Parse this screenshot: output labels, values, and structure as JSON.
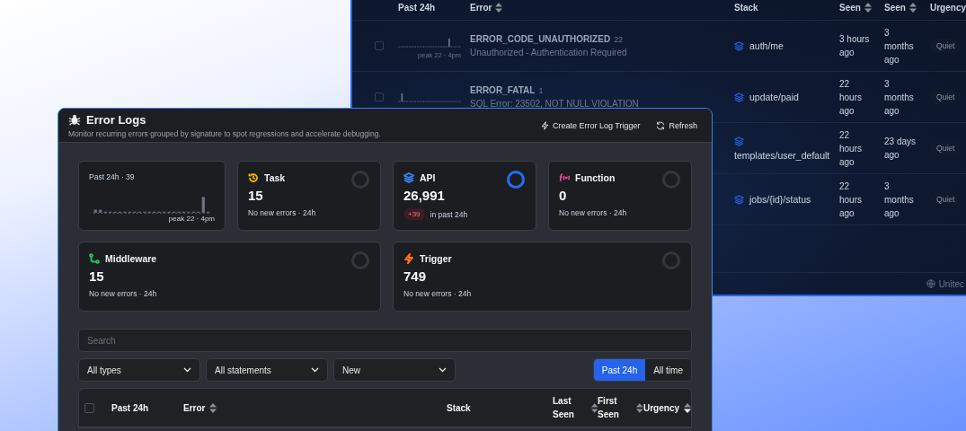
{
  "back_window": {
    "columns": [
      {
        "label": "Past 24h"
      },
      {
        "label": "Error",
        "sortable": true
      },
      {
        "label": "Stack"
      },
      {
        "label": "Seen",
        "sortable": true
      },
      {
        "label": "Seen",
        "sortable": true
      },
      {
        "label": "Urgency"
      }
    ],
    "rows": [
      {
        "checked": false,
        "peak": "peak 22 · 4pm",
        "name": "ERROR_CODE_UNAUTHORIZED",
        "count": "22",
        "message": "Unauthorized - Authentication Required",
        "stack": "auth/me",
        "last_seen": "3 hours ago",
        "first_seen": "3 months ago",
        "urgency": "Quiet"
      },
      {
        "checked": false,
        "name": "ERROR_FATAL",
        "count": "1",
        "message": "SQL Error: 23502, NOT NULL VIOLATION",
        "stack": "update/paid",
        "last_seen": "22 hours ago",
        "first_seen": "3 months ago",
        "urgency": "Quiet"
      },
      {
        "stack": "templates/user_default",
        "last_seen": "22 hours ago",
        "first_seen": "23 days ago",
        "urgency": "Quiet"
      },
      {
        "stack": "jobs/{id}/status",
        "last_seen": "22 hours ago",
        "first_seen": "3 months ago",
        "urgency": "Quiet"
      }
    ],
    "footer": "Unitec"
  },
  "panel": {
    "title": "Error Logs",
    "subtitle": "Monitor recurring errors grouped by signature to spot regressions and accelerate debugging.",
    "actions": [
      {
        "label": "Create Error Log Trigger",
        "kind": "trigger"
      },
      {
        "label": "Refresh",
        "kind": "refresh"
      }
    ]
  },
  "summary": {
    "label": "Past 24h · 39",
    "peak": "peak 22 · 4pm"
  },
  "cards": [
    {
      "kind": "task",
      "title": "Task",
      "value": "15",
      "note": "No new errors · 24h",
      "color": "#eab308",
      "level": 0
    },
    {
      "kind": "api",
      "title": "API",
      "value": "26,991",
      "delta": "+39",
      "note": "in past 24h",
      "color": "#3b82f6",
      "level": 1
    },
    {
      "kind": "function",
      "title": "Function",
      "value": "0",
      "note": "No new errors · 24h",
      "color": "#ec4899",
      "level": 0
    },
    {
      "kind": "middleware",
      "title": "Middleware",
      "value": "15",
      "note": "No new errors · 24h",
      "color": "#22c55e",
      "level": 0
    },
    {
      "kind": "trigger",
      "title": "Trigger",
      "value": "749",
      "note": "No new errors · 24h",
      "color": "#f97316",
      "level": 0
    }
  ],
  "search": {
    "placeholder": "Search"
  },
  "filters": [
    {
      "value": "All types"
    },
    {
      "value": "All statements"
    },
    {
      "value": "New"
    }
  ],
  "ranges": [
    {
      "label": "Past 24h",
      "selected": true
    },
    {
      "label": "All time",
      "selected": false
    }
  ],
  "table": {
    "select_all": {
      "checked": false
    },
    "columns": [
      {
        "label": "Past 24h"
      },
      {
        "label": "Error",
        "sortable": true,
        "sorted_desc": false
      },
      {
        "label": "Stack"
      },
      {
        "label": "Last Seen",
        "sortable": true,
        "sorted_desc": false
      },
      {
        "label": "First Seen",
        "sortable": true,
        "sorted_desc": false
      },
      {
        "label": "Urgency",
        "sortable": true,
        "sorted_desc": true
      }
    ]
  }
}
